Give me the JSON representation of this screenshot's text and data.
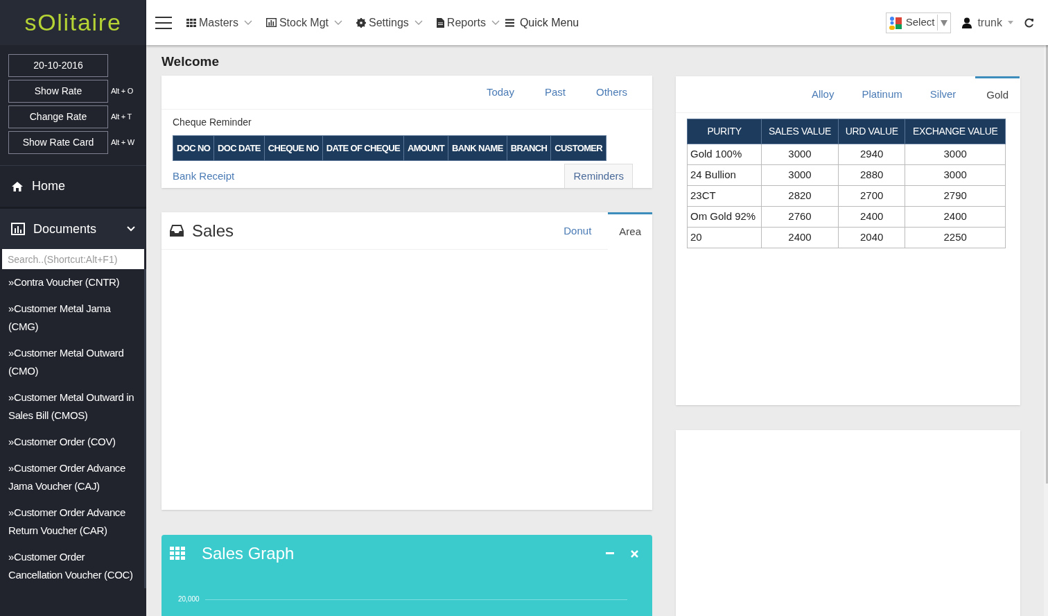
{
  "logo": "sOlitaire",
  "nav": [
    "Masters",
    "Stock Mgt",
    "Settings",
    "Reports"
  ],
  "quick_menu": "Quick Menu",
  "translate": {
    "label": "Select"
  },
  "user": "trunk",
  "sidebar": {
    "date": "20-10-2016",
    "shortcuts": [
      {
        "label": "Show Rate",
        "key": "Alt + O"
      },
      {
        "label": "Change Rate",
        "key": "Alt + T"
      },
      {
        "label": "Show Rate Card",
        "key": "Alt + W"
      }
    ],
    "home": "Home",
    "documents": {
      "label": "Documents",
      "expanded": true
    },
    "search": {
      "placeholder": "Search..(Shortcut:Alt+F1)"
    },
    "items": [
      "»Contra Voucher (CNTR)",
      "»Customer Metal Jama (CMG)",
      "»Customer Metal Outward (CMO)",
      "»Customer Metal Outward in Sales Bill (CMOS)",
      "»Customer Order (COV)",
      "»Customer Order Advance Jama Voucher (CAJ)",
      "»Customer Order Advance Return Voucher (CAR)",
      "»Customer Order Cancellation Voucher (COC)"
    ]
  },
  "page_title": "Welcome",
  "cheque": {
    "tabs": [
      {
        "label": "Today",
        "selected": false
      },
      {
        "label": "Past",
        "selected": false
      },
      {
        "label": "Others",
        "selected": false
      }
    ],
    "title": "Cheque Reminder",
    "columns": [
      "DOC NO",
      "DOC DATE",
      "CHEQUE NO",
      "DATE OF CHEQUE",
      "AMOUNT",
      "BANK NAME",
      "BRANCH",
      "CUSTOMER"
    ],
    "link": "Bank Receipt",
    "button": "Reminders"
  },
  "sales": {
    "title": "Sales",
    "tabs": [
      {
        "label": "Donut",
        "selected": false
      },
      {
        "label": "Area",
        "selected": true
      }
    ]
  },
  "sales_graph": {
    "title": "Sales Graph",
    "tick": "20,000"
  },
  "rates": {
    "tabs": [
      {
        "label": "Alloy",
        "selected": false
      },
      {
        "label": "Platinum",
        "selected": false
      },
      {
        "label": "Silver",
        "selected": false
      },
      {
        "label": "Gold",
        "selected": true
      }
    ],
    "columns": [
      "PURITY",
      "SALES VALUE",
      "URD VALUE",
      "EXCHANGE VALUE"
    ],
    "rows": [
      [
        "Gold 100%",
        "3000",
        "2940",
        "3000"
      ],
      [
        "24 Bullion",
        "3000",
        "2880",
        "3000"
      ],
      [
        "23CT",
        "2820",
        "2700",
        "2790"
      ],
      [
        "Om Gold 92%",
        "2760",
        "2400",
        "2400"
      ],
      [
        "20",
        "2400",
        "2040",
        "2250"
      ]
    ]
  }
}
